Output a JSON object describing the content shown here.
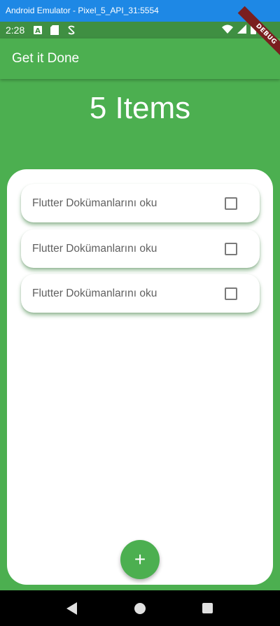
{
  "window": {
    "title": "Android Emulator - Pixel_5_API_31:5554"
  },
  "status_bar": {
    "time": "2:28",
    "debug_label": "DEBUG"
  },
  "app_bar": {
    "title": "Get it Done"
  },
  "summary": {
    "count_label": "5 Items"
  },
  "todos": [
    {
      "text": "Flutter Dokümanlarını oku",
      "checked": false
    },
    {
      "text": "Flutter Dokümanlarını oku",
      "checked": false
    },
    {
      "text": "Flutter Dokümanlarını oku",
      "checked": false
    }
  ],
  "fab": {
    "label": "+"
  },
  "colors": {
    "primary": "#4caf50",
    "window_bar": "#1e88e5",
    "background": "#ffffff"
  },
  "nav_icons": [
    "back-icon",
    "home-icon",
    "recents-icon"
  ]
}
